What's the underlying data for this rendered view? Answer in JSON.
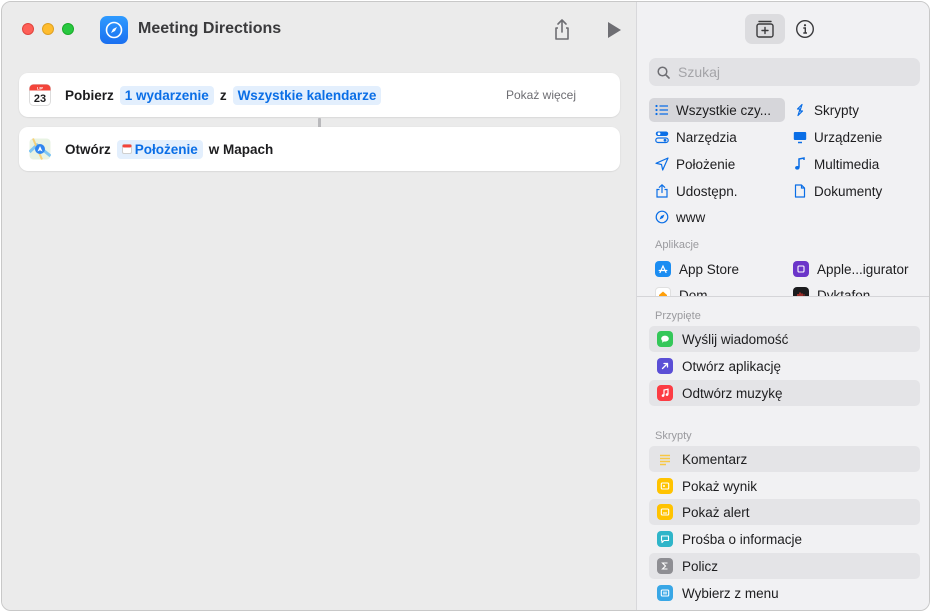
{
  "window": {
    "title": "Meeting Directions"
  },
  "actions": [
    {
      "verb": "Pobierz",
      "param1": "1 wydarzenie",
      "connector": "z",
      "param2": "Wszystkie kalendarze",
      "more": "Pokaż więcej",
      "icon_month": "LIP",
      "icon_day": "23"
    },
    {
      "verb": "Otwórz",
      "param1": "Położenie",
      "suffix": "w Mapach"
    }
  ],
  "sidebar": {
    "search_placeholder": "Szukaj",
    "categories": [
      {
        "label": "Wszystkie czy...",
        "icon": "list-icon",
        "selected": true
      },
      {
        "label": "Skrypty",
        "icon": "scripts-icon"
      },
      {
        "label": "Narzędzia",
        "icon": "toggles-icon"
      },
      {
        "label": "Urządzenie",
        "icon": "display-icon"
      },
      {
        "label": "Położenie",
        "icon": "location-arrow-icon"
      },
      {
        "label": "Multimedia",
        "icon": "music-note-icon"
      },
      {
        "label": "Udostępn.",
        "icon": "share-icon"
      },
      {
        "label": "Dokumenty",
        "icon": "document-icon"
      },
      {
        "label": "www",
        "icon": "compass-icon"
      }
    ],
    "apps_label": "Aplikacje",
    "apps": [
      {
        "label": "App Store",
        "color": "#1b8df2"
      },
      {
        "label": "Apple...igurator",
        "color": "#6b35c9"
      },
      {
        "label": "Dom",
        "color": "#ff9f0a"
      },
      {
        "label": "Dyktafon",
        "color": "#1c1c1e"
      }
    ],
    "pinned_label": "Przypięte",
    "pinned": [
      {
        "label": "Wyślij wiadomość",
        "color": "#34c759"
      },
      {
        "label": "Otwórz aplikację",
        "color": "#5b4fd6"
      },
      {
        "label": "Odtwórz muzykę",
        "color": "#fc3c44"
      }
    ],
    "scripts_label": "Skrypty",
    "scripts": [
      {
        "label": "Komentarz",
        "color": "#f7c744"
      },
      {
        "label": "Pokaż wynik",
        "color": "#ffc300"
      },
      {
        "label": "Pokaż alert",
        "color": "#ffc300"
      },
      {
        "label": "Prośba o informacje",
        "color": "#2fb5c9"
      },
      {
        "label": "Policz",
        "color": "#8e8e93"
      },
      {
        "label": "Wybierz z menu",
        "color": "#39a7e6"
      }
    ]
  }
}
